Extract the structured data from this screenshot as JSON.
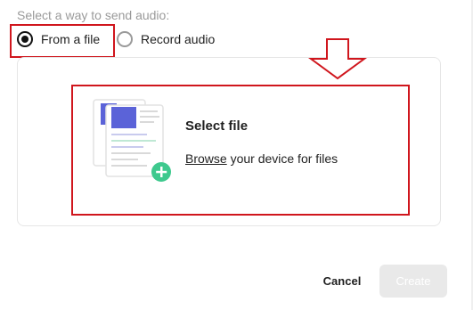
{
  "prompt": "Select a way to send audio:",
  "options": [
    {
      "label": "From a file",
      "selected": true
    },
    {
      "label": "Record audio",
      "selected": false
    }
  ],
  "dropzone": {
    "title": "Select file",
    "browse_link": "Browse",
    "browse_rest": " your device for files"
  },
  "footer": {
    "cancel_label": "Cancel",
    "create_label": "Create",
    "create_disabled": true
  },
  "colors": {
    "highlight": "#d0161d",
    "doc_accent": "#5b63d8",
    "plus_badge": "#3ec98e",
    "create_disabled_bg": "#e9e9e9"
  },
  "icons": [
    "document-stack-icon",
    "plus-icon",
    "arrow-up-icon",
    "arrow-down-icon"
  ]
}
